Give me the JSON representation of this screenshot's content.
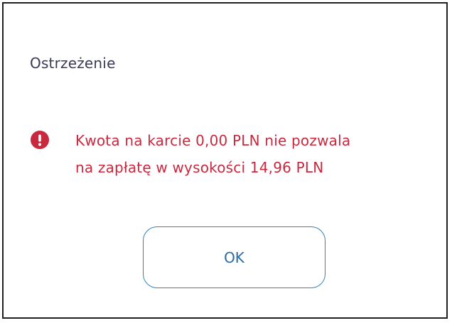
{
  "dialog": {
    "title": "Ostrzeżenie",
    "message_line1": "Kwota na karcie 0,00 PLN nie pozwala",
    "message_line2": "na zapłatę w wysokości 14,96 PLN",
    "ok_label": "OK",
    "icon": "exclamation-circle-icon"
  },
  "colors": {
    "title": "#3a3a57",
    "error": "#c8293f",
    "button_border": "#3a7fb0",
    "button_text": "#2a6aa0"
  }
}
